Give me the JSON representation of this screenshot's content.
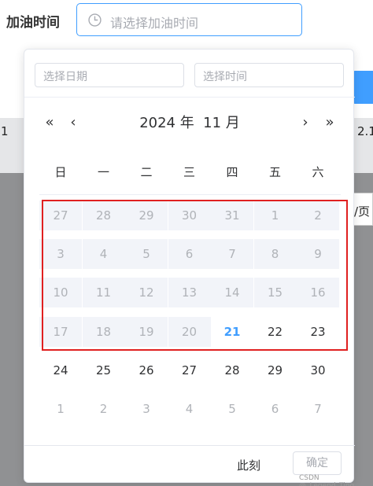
{
  "form": {
    "label": "加油时间",
    "placeholder": "请选择加油时间"
  },
  "background": {
    "left_fragment": "1",
    "right_fragment": "2.1",
    "right_fragment2": "/页"
  },
  "picker": {
    "date_placeholder": "选择日期",
    "time_placeholder": "选择时间",
    "header": {
      "year_label": "2024 年",
      "month_label": "11 月",
      "prev_year": "«",
      "prev_month": "‹",
      "next_month": "›",
      "next_year": "»"
    },
    "weekdays": [
      "日",
      "一",
      "二",
      "三",
      "四",
      "五",
      "六"
    ],
    "weeks": [
      [
        {
          "d": "27",
          "s": "muted",
          "hl": true
        },
        {
          "d": "28",
          "s": "muted",
          "hl": true
        },
        {
          "d": "29",
          "s": "muted",
          "hl": true
        },
        {
          "d": "30",
          "s": "muted",
          "hl": true
        },
        {
          "d": "31",
          "s": "muted",
          "hl": true
        },
        {
          "d": "1",
          "s": "muted",
          "hl": true
        },
        {
          "d": "2",
          "s": "muted",
          "hl": true
        }
      ],
      [
        {
          "d": "3",
          "s": "muted",
          "hl": true
        },
        {
          "d": "4",
          "s": "muted",
          "hl": true
        },
        {
          "d": "5",
          "s": "muted",
          "hl": true
        },
        {
          "d": "6",
          "s": "muted",
          "hl": true
        },
        {
          "d": "7",
          "s": "muted",
          "hl": true
        },
        {
          "d": "8",
          "s": "muted",
          "hl": true
        },
        {
          "d": "9",
          "s": "muted",
          "hl": true
        }
      ],
      [
        {
          "d": "10",
          "s": "muted",
          "hl": true
        },
        {
          "d": "11",
          "s": "muted",
          "hl": true
        },
        {
          "d": "12",
          "s": "muted",
          "hl": true
        },
        {
          "d": "13",
          "s": "muted",
          "hl": true
        },
        {
          "d": "14",
          "s": "muted",
          "hl": true
        },
        {
          "d": "15",
          "s": "muted",
          "hl": true
        },
        {
          "d": "16",
          "s": "muted",
          "hl": true
        }
      ],
      [
        {
          "d": "17",
          "s": "muted",
          "hl": true
        },
        {
          "d": "18",
          "s": "muted",
          "hl": true
        },
        {
          "d": "19",
          "s": "muted",
          "hl": true
        },
        {
          "d": "20",
          "s": "muted",
          "hl": true
        },
        {
          "d": "21",
          "s": "today",
          "hl": false
        },
        {
          "d": "22",
          "s": "norm",
          "hl": false
        },
        {
          "d": "23",
          "s": "norm",
          "hl": false
        }
      ],
      [
        {
          "d": "24",
          "s": "norm",
          "hl": false
        },
        {
          "d": "25",
          "s": "norm",
          "hl": false
        },
        {
          "d": "26",
          "s": "norm",
          "hl": false
        },
        {
          "d": "27",
          "s": "norm",
          "hl": false
        },
        {
          "d": "28",
          "s": "norm",
          "hl": false
        },
        {
          "d": "29",
          "s": "norm",
          "hl": false
        },
        {
          "d": "30",
          "s": "norm",
          "hl": false
        }
      ],
      [
        {
          "d": "1",
          "s": "muted",
          "hl": false
        },
        {
          "d": "2",
          "s": "muted",
          "hl": false
        },
        {
          "d": "3",
          "s": "muted",
          "hl": false
        },
        {
          "d": "4",
          "s": "muted",
          "hl": false
        },
        {
          "d": "5",
          "s": "muted",
          "hl": false
        },
        {
          "d": "6",
          "s": "muted",
          "hl": false
        },
        {
          "d": "7",
          "s": "muted",
          "hl": false
        }
      ]
    ],
    "now_label": "此刻",
    "confirm_label": "确定"
  },
  "colors": {
    "accent": "#409eff",
    "annotation": "#e02020"
  },
  "watermark": "CSDN @_Legend_Ting"
}
